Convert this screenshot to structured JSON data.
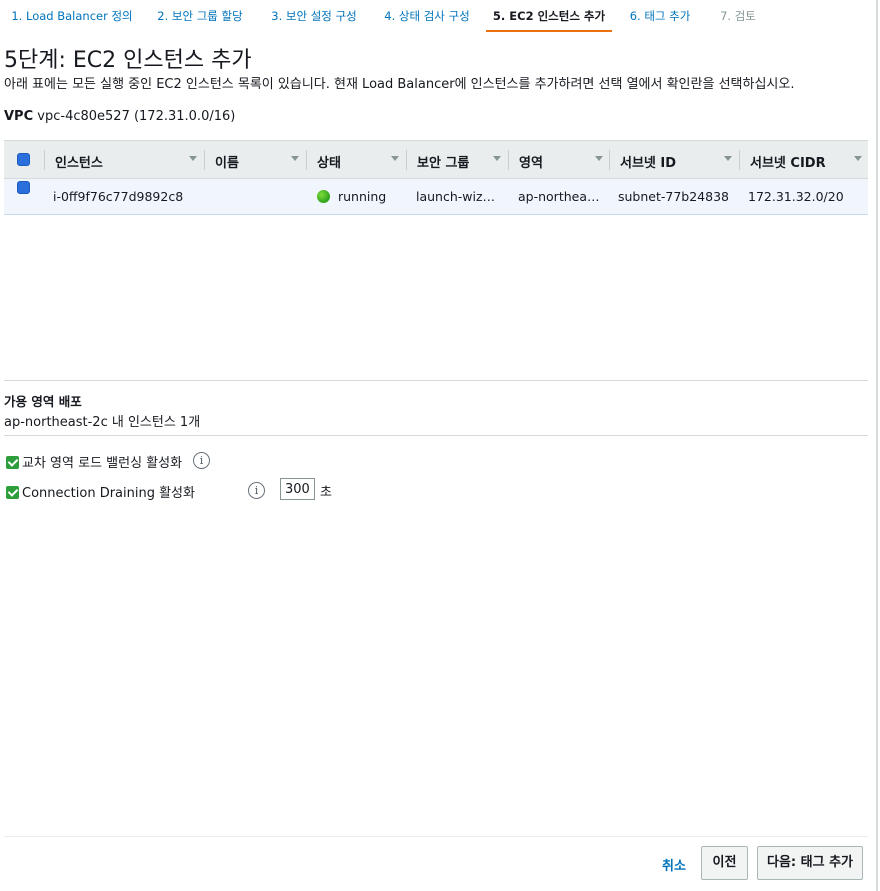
{
  "wizard": {
    "steps": [
      {
        "label": "1. Load Balancer 정의",
        "state": "link"
      },
      {
        "label": "2. 보안 그룹 할당",
        "state": "link"
      },
      {
        "label": "3. 보안 설정 구성",
        "state": "link"
      },
      {
        "label": "4. 상태 검사 구성",
        "state": "link"
      },
      {
        "label": "5. EC2 인스턴스 추가",
        "state": "active"
      },
      {
        "label": "6. 태그 추가",
        "state": "link"
      },
      {
        "label": "7. 검토",
        "state": "disabled"
      }
    ]
  },
  "page": {
    "title": "5단계: EC2 인스턴스 추가",
    "description": "아래 표에는 모든 실행 중인 EC2 인스턴스 목록이 있습니다. 현재 Load Balancer에 인스턴스를 추가하려면 선택 열에서 확인란을 선택하십시오."
  },
  "vpc": {
    "label": "VPC",
    "value": "vpc-4c80e527 (172.31.0.0/16)"
  },
  "table": {
    "columns": [
      "인스턴스",
      "이름",
      "상태",
      "보안 그룹",
      "영역",
      "서브넷 ID",
      "서브넷 CIDR"
    ],
    "rows": [
      {
        "instance": "i-0ff9f76c77d9892c8",
        "name": "",
        "status": "running",
        "security_group": "launch-wiz…",
        "zone": "ap-northea…",
        "subnet_id": "subnet-77b24838",
        "subnet_cidr": "172.31.32.0/20"
      }
    ]
  },
  "availability": {
    "title": "가용 영역 배포",
    "text": "ap-northeast-2c 내 인스턴스 1개"
  },
  "options": {
    "cross_zone": {
      "label": "교차 영역 로드 밸런싱 활성화",
      "checked": true
    },
    "draining": {
      "label": "Connection Draining 활성화",
      "checked": true,
      "timeout": "300",
      "unit": "초"
    }
  },
  "footer": {
    "cancel": "취소",
    "previous": "이전",
    "next": "다음: 태그 추가"
  },
  "colors": {
    "link": "#0073bb",
    "active_tab_underline": "#ec7211",
    "checkbox": "#2e9e3c",
    "status_running": "#2ea11b"
  }
}
